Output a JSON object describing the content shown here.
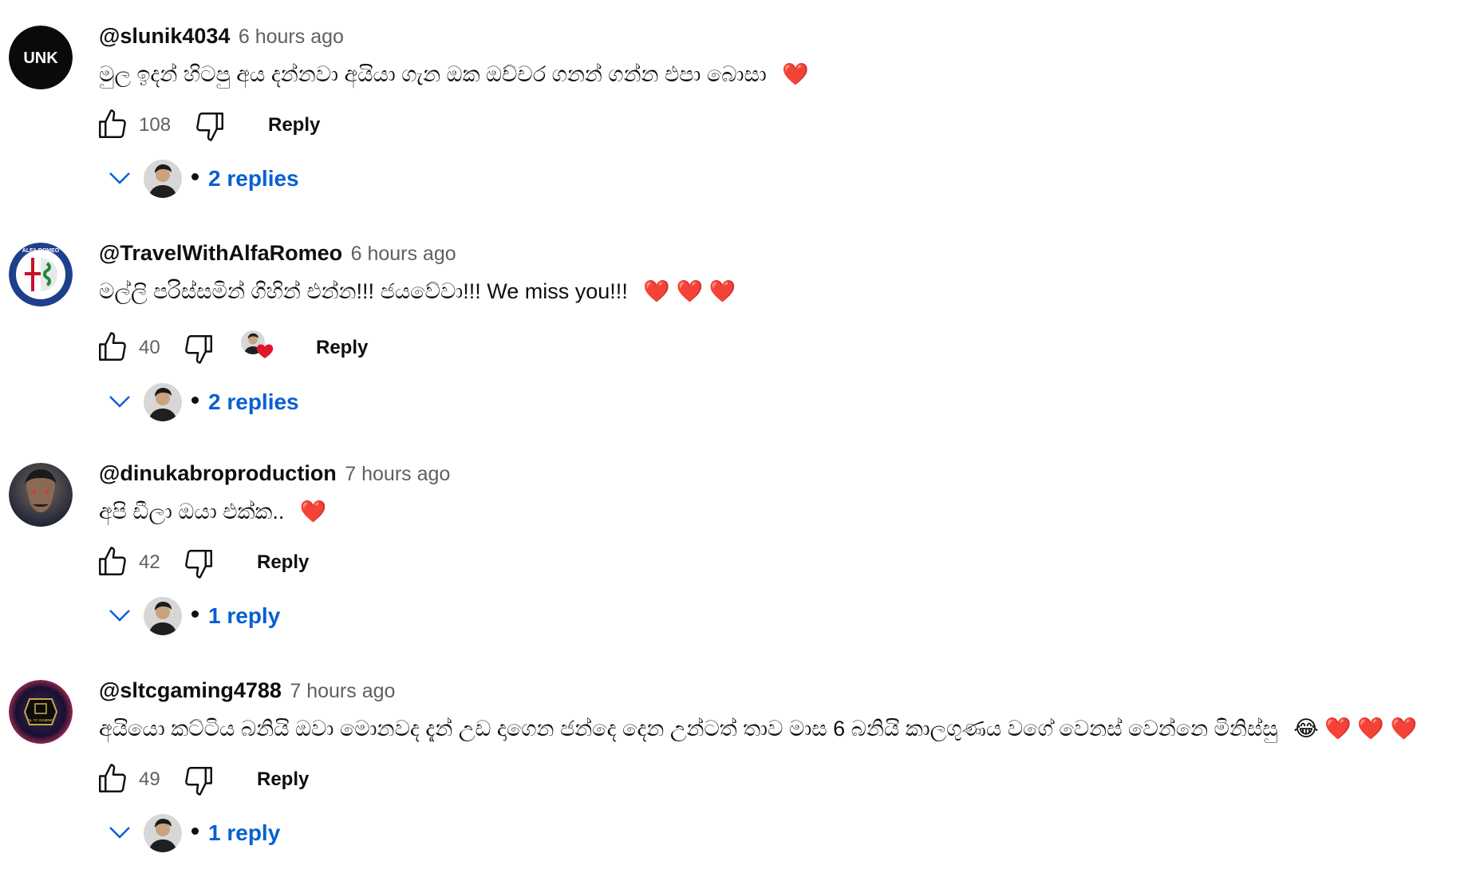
{
  "comments": [
    {
      "author": "@slunik4034",
      "time": "6 hours ago",
      "text": "මුල ඉදන් හිටපු අය දන්නවා අයියා ගැන ඔක ඔච්චර ගනන් ගන්න එපා බොසා",
      "emoji": "❤️",
      "likes": "108",
      "reply_label": "Reply",
      "replies_label": "2 replies",
      "avatar_text": "UNK",
      "creator_hearted": false
    },
    {
      "author": "@TravelWithAlfaRomeo",
      "time": "6 hours ago",
      "text": "මල්ලි පරිස්සමින් ගිහින් එන්න!!! ජයවේවා!!! We miss you!!!",
      "emoji": "❤️ ❤️ ❤️",
      "likes": "40",
      "reply_label": "Reply",
      "replies_label": "2 replies",
      "avatar_text": "ALFA ROMEO",
      "creator_hearted": true
    },
    {
      "author": "@dinukabroproduction",
      "time": "7 hours ago",
      "text": "අපි ඩීලා ඔයා එක්ක..",
      "emoji": "❤️",
      "likes": "42",
      "reply_label": "Reply",
      "replies_label": "1 reply",
      "avatar_text": "",
      "creator_hearted": false
    },
    {
      "author": "@sltcgaming4788",
      "time": "7 hours ago",
      "text": "අයියො කට්ටිය බනියි ඔවා මොනවද  දැන් උඩ දාගෙන ජන්දෙ දෙන උන්ටත්  තාව මාස 6 බනියි  කාලගුණය වගේ වෙනස් වෙන්නෙ මිනිස්සු",
      "emoji": "😂 ❤️ ❤️ ❤️",
      "likes": "49",
      "reply_label": "Reply",
      "replies_label": "1 reply",
      "avatar_text": "SL TC GAMING",
      "creator_hearted": false
    }
  ],
  "colors": {
    "link_blue": "#065fd4",
    "meta_gray": "#606060",
    "heart_red": "#e0162b"
  },
  "icons": [
    "like-icon",
    "dislike-icon",
    "chevron-down-icon",
    "heart-icon"
  ]
}
